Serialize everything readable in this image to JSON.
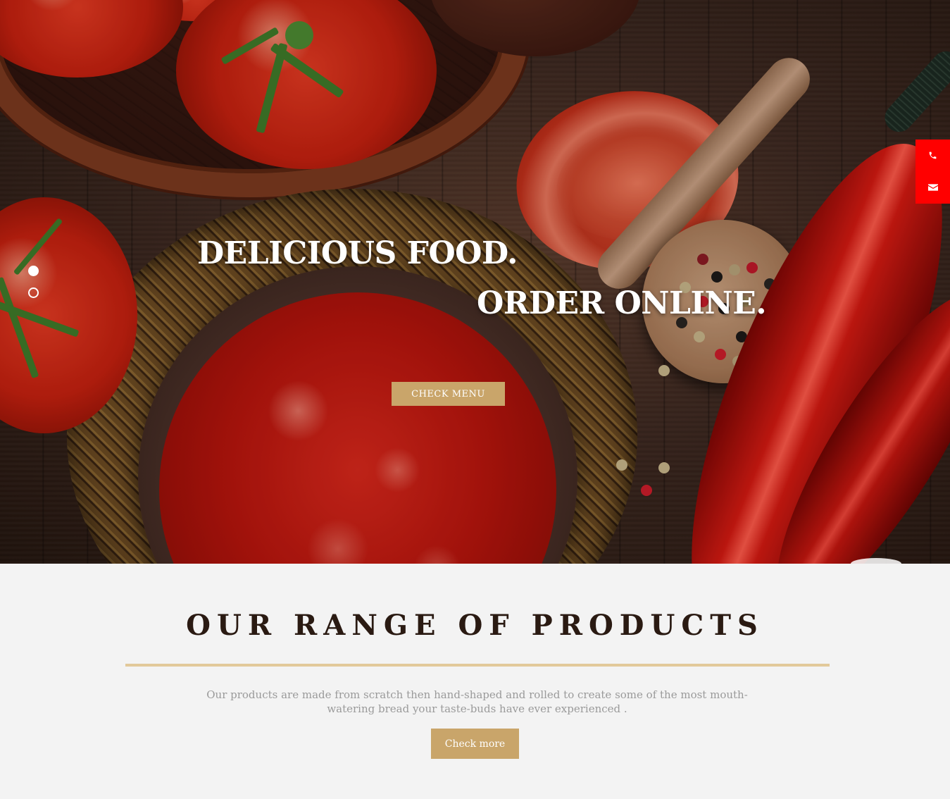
{
  "hero": {
    "headline_line1": "DELICIOUS FOOD.",
    "headline_line2": "ORDER ONLINE.",
    "cta_label": "CHECK MENU",
    "slides": [
      {
        "state": "active"
      },
      {
        "state": "inactive"
      }
    ]
  },
  "contact": {
    "phone_icon": "phone-icon",
    "email_icon": "envelope-icon",
    "color": "#ff0000"
  },
  "products": {
    "title": "OUR RANGE OF PRODUCTS",
    "description": "Our products are made from scratch then hand-shaped and rolled to create some of the most mouth-watering bread your taste-buds have ever experienced .",
    "button_label": "Check more"
  },
  "theme": {
    "accent": "#c9a56a",
    "title_color": "#2a1a12",
    "rule_color": "#e2c99a",
    "background": "#f3f3f3"
  }
}
